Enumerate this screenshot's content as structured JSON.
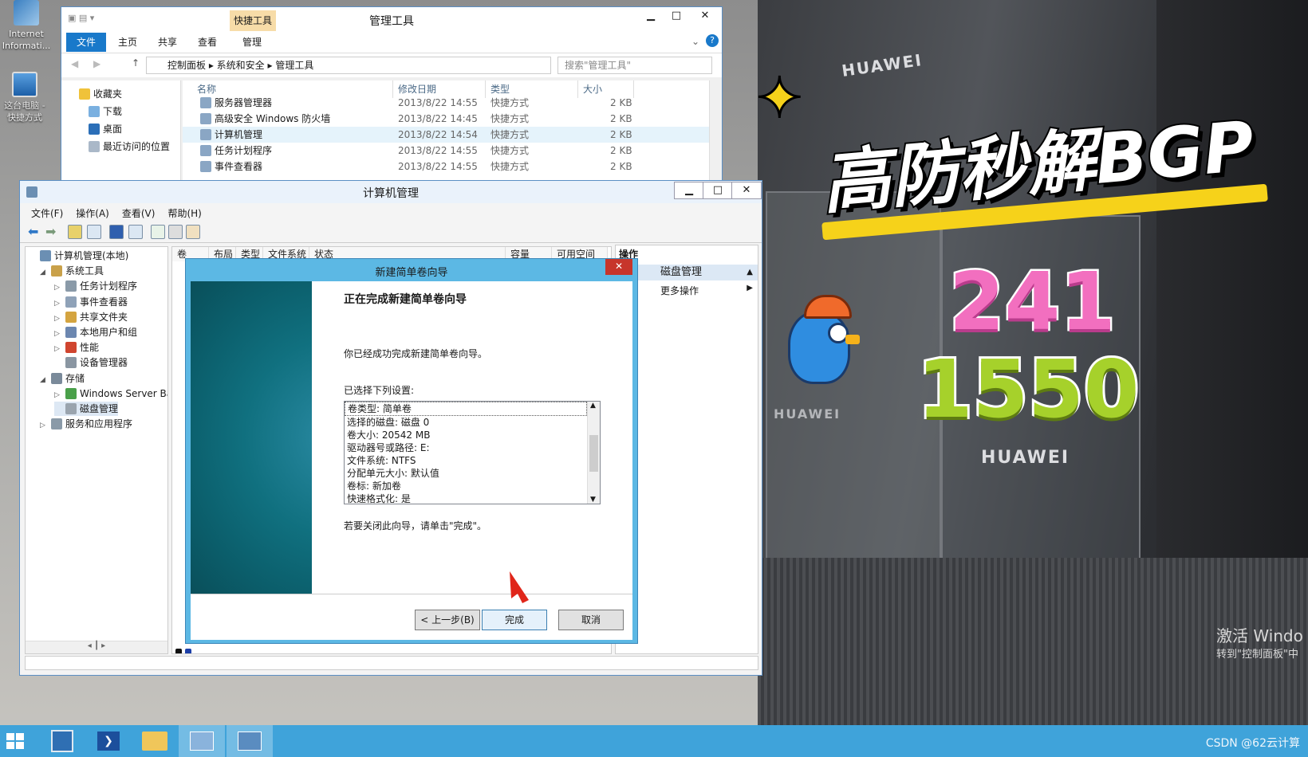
{
  "desktop": {
    "icons": [
      {
        "label": "Internet\nInformati..."
      },
      {
        "label": "这台电脑 -\n快捷方式"
      }
    ]
  },
  "promo": {
    "title": "高防秒解BGP",
    "number1": "241",
    "number2": "1550",
    "brand": "HUAWEI",
    "activate_line1": "激活 Windo",
    "activate_line2": "转到\"控制面板\"中"
  },
  "explorer": {
    "title": "管理工具",
    "context_tab": "快捷工具",
    "tabs": [
      "文件",
      "主页",
      "共享",
      "查看",
      "管理"
    ],
    "breadcrumb": [
      "控制面板",
      "系统和安全",
      "管理工具"
    ],
    "search_placeholder": "搜索\"管理工具\"",
    "nav_items": [
      "收藏夹",
      "下载",
      "桌面",
      "最近访问的位置"
    ],
    "columns": [
      "名称",
      "修改日期",
      "类型",
      "大小"
    ],
    "files": [
      {
        "name": "服务器管理器",
        "date": "2013/8/22 14:55",
        "type": "快捷方式",
        "size": "2 KB"
      },
      {
        "name": "高级安全 Windows 防火墙",
        "date": "2013/8/22 14:45",
        "type": "快捷方式",
        "size": "2 KB"
      },
      {
        "name": "计算机管理",
        "date": "2013/8/22 14:54",
        "type": "快捷方式",
        "size": "2 KB"
      },
      {
        "name": "任务计划程序",
        "date": "2013/8/22 14:55",
        "type": "快捷方式",
        "size": "2 KB"
      },
      {
        "name": "事件查看器",
        "date": "2013/8/22 14:55",
        "type": "快捷方式",
        "size": "2 KB"
      }
    ]
  },
  "compmgmt": {
    "title": "计算机管理",
    "menu": [
      "文件(F)",
      "操作(A)",
      "查看(V)",
      "帮助(H)"
    ],
    "tree": [
      {
        "label": "计算机管理(本地)",
        "level": 0
      },
      {
        "label": "系统工具",
        "level": 1
      },
      {
        "label": "任务计划程序",
        "level": 2
      },
      {
        "label": "事件查看器",
        "level": 2
      },
      {
        "label": "共享文件夹",
        "level": 2
      },
      {
        "label": "本地用户和组",
        "level": 2
      },
      {
        "label": "性能",
        "level": 2
      },
      {
        "label": "设备管理器",
        "level": 2
      },
      {
        "label": "存储",
        "level": 1
      },
      {
        "label": "Windows Server Back",
        "level": 2
      },
      {
        "label": "磁盘管理",
        "level": 2
      },
      {
        "label": "服务和应用程序",
        "level": 1
      }
    ],
    "columns": [
      "卷",
      "布局",
      "类型",
      "文件系统",
      "状态",
      "容量",
      "可用空间"
    ],
    "actions_header": "操作",
    "actions_section": "磁盘管理",
    "actions_more": "更多操作"
  },
  "wizard": {
    "title": "新建简单卷向导",
    "heading": "正在完成新建简单卷向导",
    "intro": "你已经成功完成新建简单卷向导。",
    "settings_label": "已选择下列设置:",
    "settings": [
      "卷类型: 简单卷",
      "选择的磁盘: 磁盘 0",
      "卷大小: 20542 MB",
      "驱动器号或路径: E:",
      "文件系统: NTFS",
      "分配单元大小: 默认值",
      "卷标: 新加卷",
      "快速格式化: 是"
    ],
    "close_hint": "若要关闭此向导，请单击\"完成\"。",
    "back_button": "< 上一步(B)",
    "finish_button": "完成",
    "cancel_button": "取消"
  },
  "taskbar": {
    "watermark": "CSDN @62云计算"
  }
}
